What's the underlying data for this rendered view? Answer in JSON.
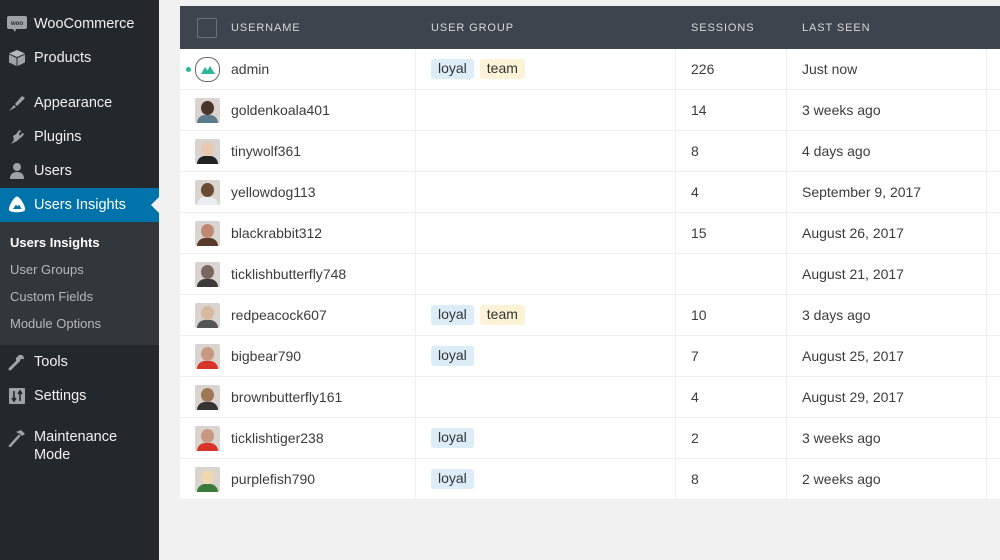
{
  "sidebar": {
    "items": [
      {
        "label": "WooCommerce",
        "icon": "woo-icon"
      },
      {
        "label": "Products",
        "icon": "box-icon"
      },
      {
        "label": "Appearance",
        "icon": "paintbrush-icon"
      },
      {
        "label": "Plugins",
        "icon": "plug-icon"
      },
      {
        "label": "Users",
        "icon": "user-icon"
      },
      {
        "label": "Users Insights",
        "icon": "users-insights-icon",
        "active": true
      },
      {
        "label": "Tools",
        "icon": "wrench-icon"
      },
      {
        "label": "Settings",
        "icon": "settings-icon"
      },
      {
        "label": "Maintenance Mode",
        "icon": "hammer-icon"
      }
    ],
    "submenu": [
      {
        "label": "Users Insights",
        "current": true
      },
      {
        "label": "User Groups"
      },
      {
        "label": "Custom Fields"
      },
      {
        "label": "Module Options"
      }
    ],
    "colors": {
      "bg": "#23282d",
      "active": "#0073aa",
      "submenu_bg": "#32373c"
    }
  },
  "table": {
    "headers": {
      "username": "USERNAME",
      "user_group": "USER GROUP",
      "sessions": "SESSIONS",
      "last_seen": "LAST SEEN"
    },
    "rows": [
      {
        "username": "admin",
        "groups": [
          "loyal",
          "team"
        ],
        "sessions": "226",
        "last_seen": "Just now",
        "online": true
      },
      {
        "username": "goldenkoala401",
        "groups": [],
        "sessions": "14",
        "last_seen": "3 weeks ago"
      },
      {
        "username": "tinywolf361",
        "groups": [],
        "sessions": "8",
        "last_seen": "4 days ago"
      },
      {
        "username": "yellowdog113",
        "groups": [],
        "sessions": "4",
        "last_seen": "September 9, 2017"
      },
      {
        "username": "blackrabbit312",
        "groups": [],
        "sessions": "15",
        "last_seen": "August 26, 2017"
      },
      {
        "username": "ticklishbutterfly748",
        "groups": [],
        "sessions": "",
        "last_seen": "August 21, 2017"
      },
      {
        "username": "redpeacock607",
        "groups": [
          "loyal",
          "team"
        ],
        "sessions": "10",
        "last_seen": "3 days ago"
      },
      {
        "username": "bigbear790",
        "groups": [
          "loyal"
        ],
        "sessions": "7",
        "last_seen": "August 25, 2017"
      },
      {
        "username": "brownbutterfly161",
        "groups": [],
        "sessions": "4",
        "last_seen": "August 29, 2017"
      },
      {
        "username": "ticklishtiger238",
        "groups": [
          "loyal"
        ],
        "sessions": "2",
        "last_seen": "3 weeks ago"
      },
      {
        "username": "purplefish790",
        "groups": [
          "loyal"
        ],
        "sessions": "8",
        "last_seen": "2 weeks ago"
      }
    ],
    "tag_colors": {
      "loyal": "#dcedf7",
      "team": "#fcf3d6"
    },
    "header_bg": "#3e444d",
    "online_color": "#2bb59a"
  }
}
